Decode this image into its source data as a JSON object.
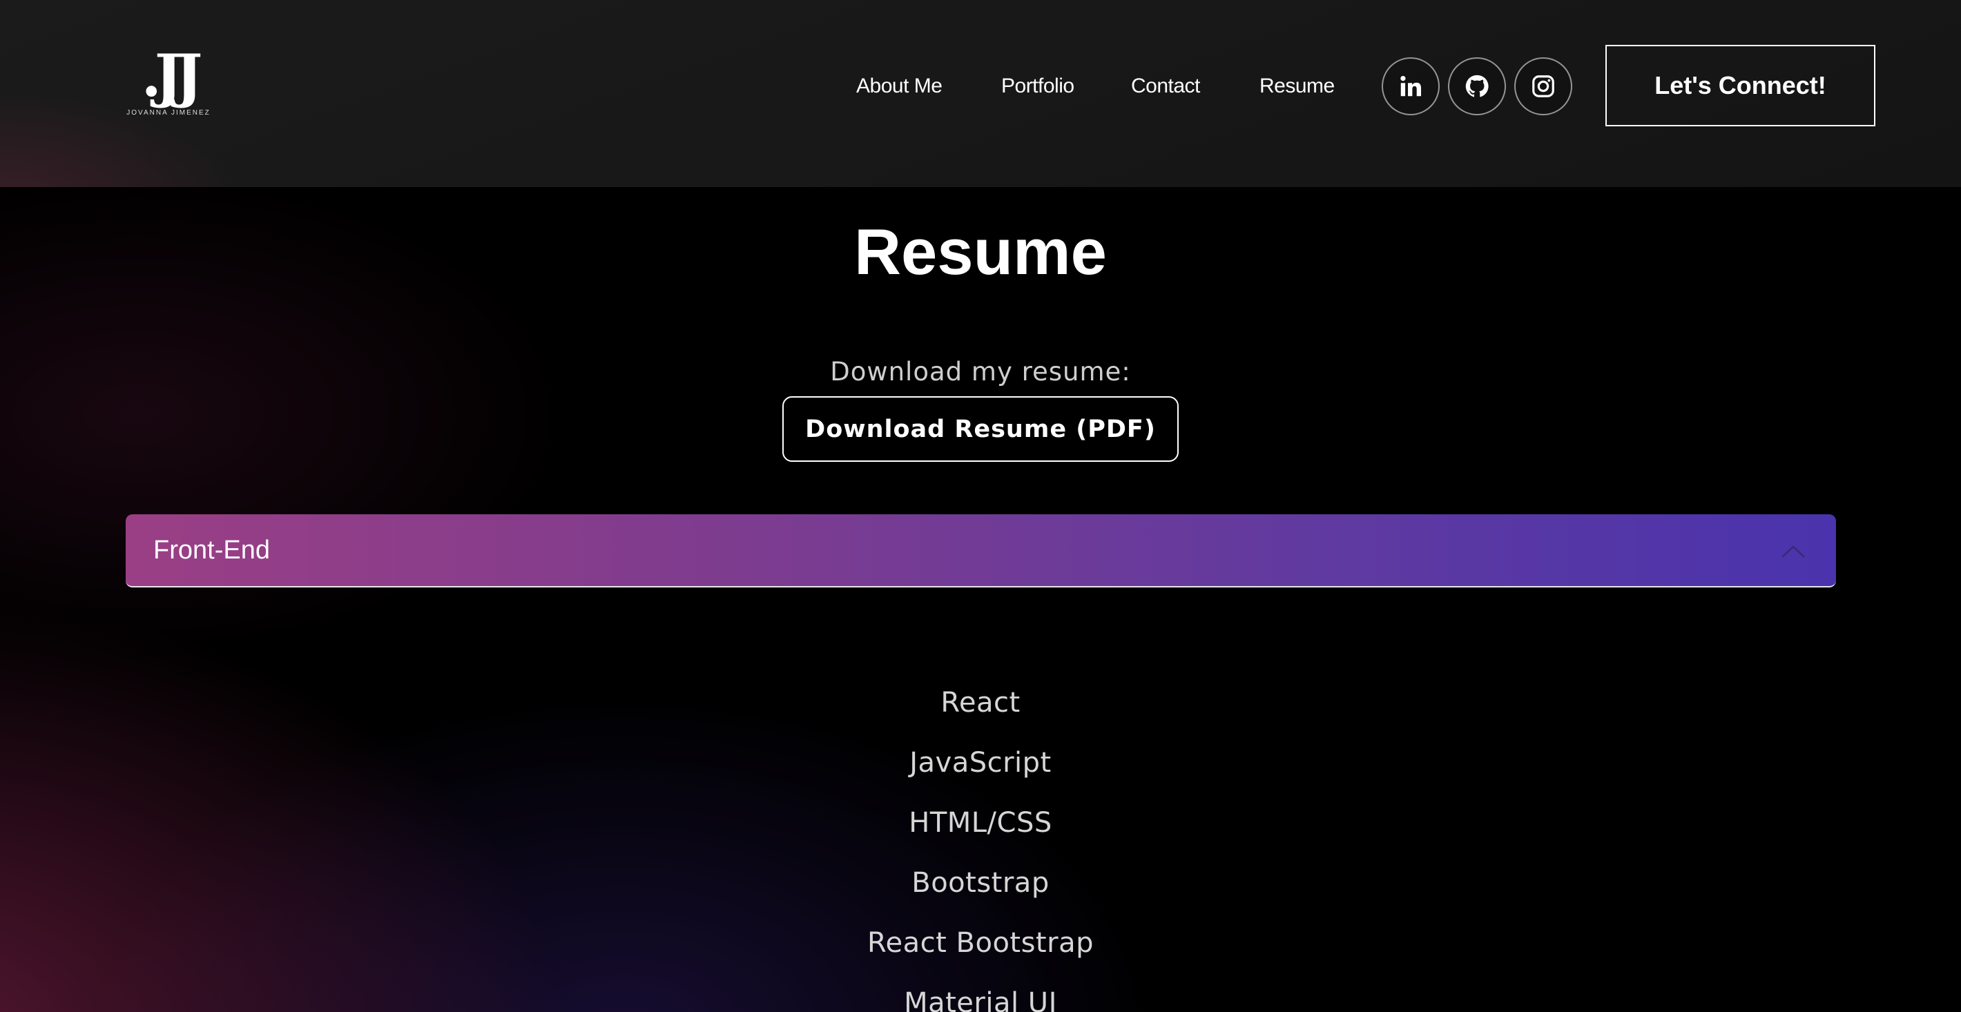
{
  "brand": {
    "logo_mark": ".JJ",
    "name": "JOVANNA JIMENEZ"
  },
  "nav": {
    "links": [
      {
        "label": "About Me"
      },
      {
        "label": "Portfolio"
      },
      {
        "label": "Contact"
      },
      {
        "label": "Resume"
      }
    ],
    "social": [
      {
        "icon": "linkedin-icon"
      },
      {
        "icon": "github-icon"
      },
      {
        "icon": "instagram-icon"
      }
    ],
    "cta_label": "Let's Connect!"
  },
  "main": {
    "title": "Resume",
    "download_label": "Download my resume:",
    "download_button": "Download Resume (PDF)",
    "accordion": {
      "title": "Front-End",
      "expanded": true,
      "items": [
        "React",
        "JavaScript",
        "HTML/CSS",
        "Bootstrap",
        "React Bootstrap",
        "Material UI"
      ]
    }
  },
  "colors": {
    "accordion_start": "#9a3f85",
    "accordion_end": "#4a33ad",
    "background": "#000000",
    "navbar": "#181818"
  }
}
